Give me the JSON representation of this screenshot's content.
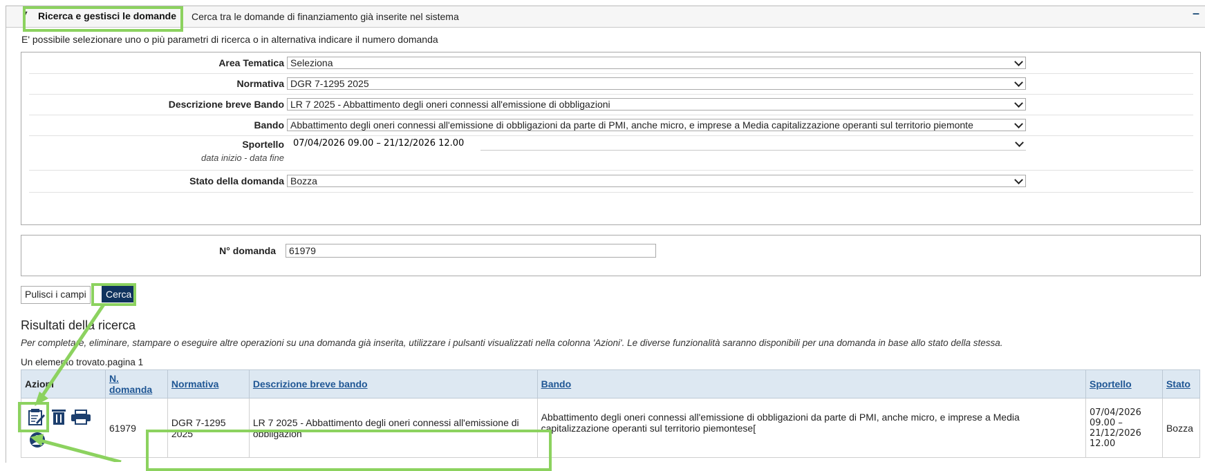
{
  "header": {
    "title": "Ricerca e gestisci le domande",
    "subtitle": "Cerca tra le domande di finanziamento già inserite nel sistema",
    "collapse_symbol": "–"
  },
  "intro": "E' possibile selezionare uno o più parametri di ricerca o in alternativa indicare il numero domanda",
  "filters": {
    "area_label": "Area Tematica",
    "area_value": "Seleziona",
    "normativa_label": "Normativa",
    "normativa_value": "DGR 7-1295 2025",
    "descr_label": "Descrizione breve Bando",
    "descr_value": "LR 7 2025 - Abbattimento degli oneri connessi all'emissione di obbligazioni",
    "bando_label": "Bando",
    "bando_value": "Abbattimento degli oneri connessi all'emissione di obbligazioni da parte di PMI, anche micro, e imprese a Media capitalizzazione operanti sul territorio piemonte",
    "sportello_label": "Sportello",
    "sportello_sub": "data inizio - data fine",
    "sportello_value": "07/04/2026 09.00 – 21/12/2026 12.00",
    "stato_label": "Stato della domanda",
    "stato_value": "Bozza"
  },
  "numero": {
    "label": "N° domanda",
    "value": "61979"
  },
  "buttons": {
    "pulisci": "Pulisci i campi",
    "cerca": "Cerca"
  },
  "results": {
    "heading": "Risultati della ricerca",
    "note": "Per completare, eliminare, stampare o eseguire altre operazioni su una domanda già inserita, utilizzare i pulsanti visualizzati nella colonna 'Azioni'. Le diverse funzionalità saranno disponibili per una domanda in base allo stato della stessa.",
    "count": "Un elemento trovato.pagina 1",
    "columns": {
      "azioni": "Azioni",
      "n_domanda": "N. domanda",
      "normativa": "Normativa",
      "descrizione": "Descrizione breve bando",
      "bando": "Bando",
      "sportello": "Sportello",
      "stato": "Stato"
    },
    "rows": [
      {
        "n_domanda": "61979",
        "normativa": "DGR 7-1295 2025",
        "descrizione": "LR 7 2025 - Abbattimento degli oneri connessi all'emissione di obbligazion",
        "bando": "Abbattimento degli oneri connessi all'emissione di obbligazioni da parte di PMI, anche micro, e imprese a Media capitalizzazione operanti sul territorio piemontese[",
        "sportello": "07/04/2026 09.00 – 21/12/2026 12.00",
        "stato": "Bozza"
      }
    ]
  },
  "icons": {
    "edit": "edit-icon",
    "delete": "trash-icon",
    "print": "print-icon",
    "user": "user-icon"
  },
  "colors": {
    "highlight": "#8cd25f",
    "primary_button": "#10335e",
    "table_header_bg": "#dde8f2",
    "link": "#1f5694"
  }
}
